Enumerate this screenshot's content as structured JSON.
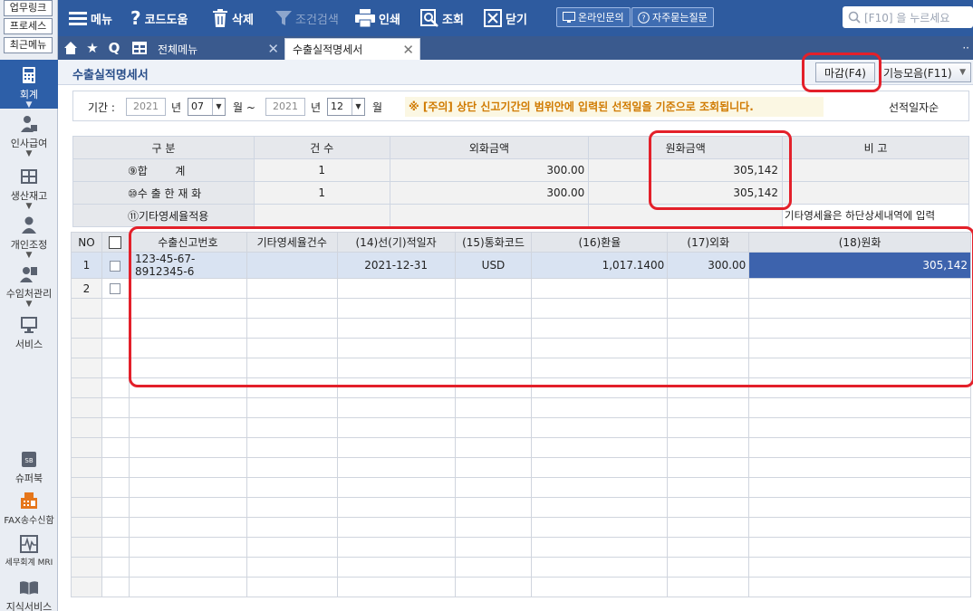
{
  "sidebar": {
    "quick_links": [
      "업무링크",
      "프로세스",
      "최근메뉴"
    ],
    "items": [
      {
        "label": "회계",
        "icon": "calculator-icon"
      },
      {
        "label": "인사급여",
        "icon": "person-icon"
      },
      {
        "label": "생산재고",
        "icon": "warehouse-icon"
      },
      {
        "label": "개인조정",
        "icon": "user-icon"
      },
      {
        "label": "수임처관리",
        "icon": "clients-icon"
      },
      {
        "label": "서비스",
        "icon": "monitor-icon"
      },
      {
        "label": "슈퍼북",
        "icon": "superbook-icon"
      },
      {
        "label": "FAX송수신함",
        "icon": "fax-icon"
      },
      {
        "label": "세무회계 MRI",
        "icon": "pulse-icon"
      },
      {
        "label": "지식서비스",
        "icon": "book-icon"
      }
    ]
  },
  "toolbar": {
    "menu": "메뉴",
    "code_help": "코드도움",
    "delete": "삭제",
    "condition_search": "조건검색",
    "print": "인쇄",
    "lookup": "조회",
    "close": "닫기",
    "online_inquiry": "온라인문의",
    "faq": "자주묻는질문",
    "search_placeholder": "[F10] 을 누르세요"
  },
  "tabs": {
    "all_menu": "전체메뉴",
    "current": "수출실적명세서"
  },
  "page": {
    "title": "수출실적명세서",
    "close_button": "마감(F4)",
    "functions_button": "기능모음(F11)"
  },
  "filter": {
    "period_label": "기간 :",
    "from_year": "2021",
    "year_unit": "년",
    "from_month": "07",
    "month_unit_tilde": "월 ~",
    "to_year": "2021",
    "to_month": "12",
    "month_unit": "월",
    "notice": "※ [주의] 상단 신고기간의 범위안에 입력된 선적일을 기준으로 조회됩니다.",
    "sort_label": "선적일자순"
  },
  "summary": {
    "headers": [
      "구 분",
      "건 수",
      "외화금액",
      "원화금액",
      "비 고"
    ],
    "rows": [
      {
        "label": "⑨합        계",
        "count": "1",
        "foreign": "300.00",
        "won": "305,142",
        "note": ""
      },
      {
        "label": "⑩수 출 한 재 화",
        "count": "1",
        "foreign": "300.00",
        "won": "305,142",
        "note": ""
      },
      {
        "label": "⑪기타영세율적용",
        "count": "",
        "foreign": "",
        "won": "",
        "note": "기타영세율은 하단상세내역에 입력"
      }
    ]
  },
  "grid": {
    "headers": [
      "NO",
      "",
      "수출신고번호",
      "기타영세율건수",
      "(14)선(기)적일자",
      "(15)통화코드",
      "(16)환율",
      "(17)외화",
      "(18)원화"
    ],
    "rows": [
      {
        "no": "1",
        "export_no": "123-45-67-8912345-6",
        "other_count": "",
        "ship_date": "2021-12-31",
        "currency": "USD",
        "rate": "1,017.1400",
        "foreign": "300.00",
        "won": "305,142"
      },
      {
        "no": "2",
        "export_no": "",
        "other_count": "",
        "ship_date": "",
        "currency": "",
        "rate": "",
        "foreign": "",
        "won": ""
      }
    ]
  },
  "colors": {
    "toolbar_bg": "#2e5b9f",
    "highlight": "#3d63ad",
    "notice": "#d07a00",
    "annotation_red": "#e3202a"
  }
}
